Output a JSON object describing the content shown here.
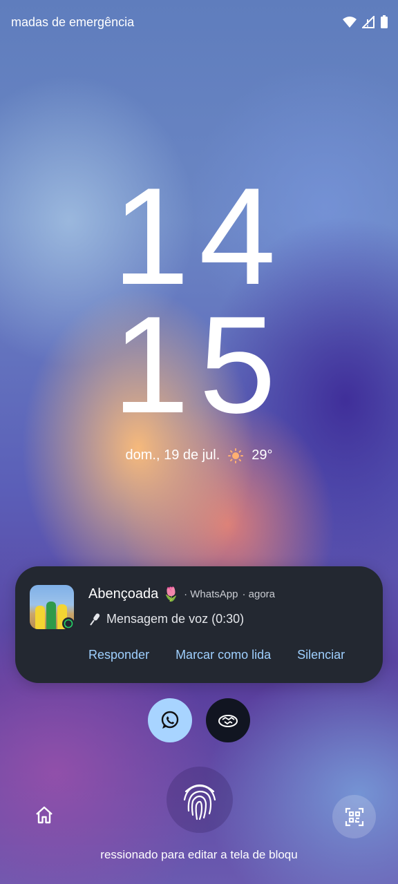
{
  "status_bar": {
    "text": "madas de emergência",
    "icons": [
      "wifi-icon",
      "signal-icon",
      "battery-icon"
    ]
  },
  "clock": {
    "hour": "14",
    "minute": "15"
  },
  "date": {
    "text": "dom., 19 de jul.",
    "weather_icon": "sun-icon",
    "temperature": "29°"
  },
  "notification": {
    "title": "Abençoada",
    "title_emoji": "🌷",
    "app": "· WhatsApp",
    "time": "· agora",
    "body_icon": "microphone-icon",
    "body": "Mensagem de voz (0:30)",
    "actions": {
      "reply": "Responder",
      "mark_read": "Marcar como lida",
      "mute": "Silenciar"
    }
  },
  "shortcuts": [
    {
      "icon": "whatsapp-icon",
      "color": "#a8d4ff"
    },
    {
      "icon": "app-shortcut-icon",
      "color": "#111521"
    }
  ],
  "bottom": {
    "home_icon": "home-icon",
    "fingerprint_icon": "fingerprint-icon",
    "qr_icon": "qr-scanner-icon",
    "hint": "ressionado para editar a tela de bloqu"
  },
  "colors": {
    "notification_bg": "#232831",
    "action_text": "#9fd0ff"
  }
}
